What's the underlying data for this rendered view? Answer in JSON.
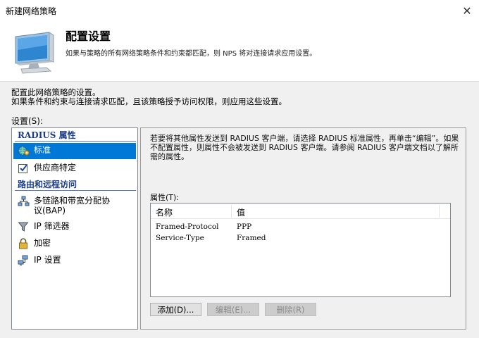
{
  "window": {
    "title": "新建网络策略",
    "close_glyph": "✕"
  },
  "header": {
    "title": "配置设置",
    "description": "如果与策略的所有网络策略条件和约束都匹配，则 NPS 将对连接请求应用设置。"
  },
  "intro": {
    "line1": "配置此网络策略的设置。",
    "line2": "如果条件和约束与连接请求匹配，且该策略授予访问权限，则应用这些设置。"
  },
  "settings_label": "设置(S):",
  "sidebar": {
    "groups": [
      {
        "label": "RADIUS 属性"
      },
      {
        "label": "路由和远程访问"
      }
    ],
    "items": [
      {
        "label": "标准",
        "icon": "globe-gear-icon",
        "selected": true
      },
      {
        "label": "供应商特定",
        "icon": "checkbox-icon",
        "selected": false
      },
      {
        "label_line1": "多链路和带宽分配协",
        "label_line2": "议(BAP)",
        "icon": "network-icon",
        "selected": false
      },
      {
        "label": "IP 筛选器",
        "icon": "funnel-icon",
        "selected": false
      },
      {
        "label": "加密",
        "icon": "lock-icon",
        "selected": false
      },
      {
        "label": "IP 设置",
        "icon": "computers-icon",
        "selected": false
      }
    ]
  },
  "detail": {
    "description": "若要将其他属性发送到 RADIUS 客户端，请选择 RADIUS 标准属性，再单击“编辑”。如果不配置属性，则属性不会被发送到 RADIUS 客户端。请参阅 RADIUS 客户端文档以了解所需的属性。",
    "attributes_label": "属性(T):",
    "columns": {
      "name": "名称",
      "value": "值"
    },
    "rows": [
      {
        "name": "Framed-Protocol",
        "value": "PPP"
      },
      {
        "name": "Service-Type",
        "value": "Framed"
      }
    ],
    "buttons": {
      "add": "添加(D)...",
      "edit": "编辑(E)...",
      "remove": "删除(R)"
    }
  },
  "colors": {
    "selection": "#0078d7",
    "group_heading": "#1c3d8a"
  }
}
